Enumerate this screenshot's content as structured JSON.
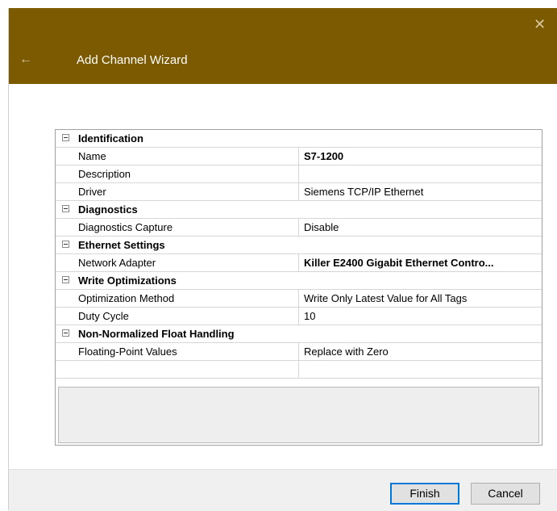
{
  "window": {
    "title": "Add Channel Wizard",
    "back_icon": "arrow-left-icon",
    "close_icon": "close-icon",
    "accent_color": "#7b5a01"
  },
  "grid": {
    "rows": [
      {
        "type": "category",
        "label": "Identification"
      },
      {
        "type": "property",
        "name": "Name",
        "value": "S7-1200",
        "bold": true
      },
      {
        "type": "property",
        "name": "Description",
        "value": ""
      },
      {
        "type": "property",
        "name": "Driver",
        "value": "Siemens TCP/IP Ethernet"
      },
      {
        "type": "category",
        "label": "Diagnostics"
      },
      {
        "type": "property",
        "name": "Diagnostics Capture",
        "value": "Disable"
      },
      {
        "type": "category",
        "label": "Ethernet Settings"
      },
      {
        "type": "property",
        "name": "Network Adapter",
        "value": "Killer E2400 Gigabit Ethernet Contro...",
        "bold": true
      },
      {
        "type": "category",
        "label": "Write Optimizations"
      },
      {
        "type": "property",
        "name": "Optimization Method",
        "value": "Write Only Latest Value for All Tags"
      },
      {
        "type": "property",
        "name": "Duty Cycle",
        "value": "10"
      },
      {
        "type": "category",
        "label": "Non-Normalized Float Handling"
      },
      {
        "type": "property",
        "name": "Floating-Point Values",
        "value": "Replace with Zero"
      }
    ]
  },
  "buttons": {
    "finish": "Finish",
    "cancel": "Cancel"
  }
}
